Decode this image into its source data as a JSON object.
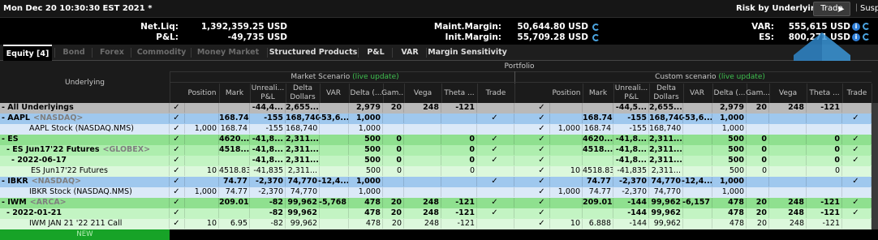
{
  "window": {
    "title": "Mon Dec 20 10:30:30 EST 2021 *",
    "risk_by": "Risk by Underlying",
    "trade_btn": "Trade",
    "susp": "Susp"
  },
  "summary": {
    "netliq_label": "Net.Liq:",
    "netliq_value": "1,392,359.25 USD",
    "pnl_label": "P&L:",
    "pnl_value": "-49,735 USD",
    "maint_label": "Maint.Margin:",
    "maint_value": "50,644.80 USD",
    "init_label": "Init.Margin:",
    "init_value": "55,709.28 USD",
    "var_label": "VAR:",
    "var_value": "555,615 USD",
    "es_label": "ES:",
    "es_value": "800,271 USD"
  },
  "tabs": [
    "Equity [4]",
    "Bond",
    "Forex",
    "Commodity",
    "Money Market",
    "Structured Products",
    "P&L",
    "VAR",
    "Margin Sensitivity"
  ],
  "headers": {
    "portfolio": "Portfolio",
    "underlying": "Underlying",
    "market_scenario": "Market Scenario",
    "custom_scenario": "Custom scenario",
    "live_update": "(live update)",
    "cols": [
      "Position",
      "Mark",
      "Unreali... P&L",
      "Delta Dollars",
      "VAR",
      "Delta (...",
      "Gam...",
      "Vega",
      "Theta ...",
      "Trade"
    ]
  },
  "rows": [
    {
      "name": "- All Underlyings",
      "ex": "",
      "bg": "#b9b9b9",
      "bold": true,
      "trade": false,
      "m": [
        "",
        "",
        "-44,4...",
        "2,655...",
        "",
        "2,979",
        "20",
        "248",
        "-121",
        ""
      ],
      "c": [
        "",
        "",
        "-44,5...",
        "2,655...",
        "",
        "2,979",
        "20",
        "248",
        "-121",
        ""
      ]
    },
    {
      "name": "- AAPL",
      "ex": "<NASDAQ>",
      "bg": "#9fc8ee",
      "bold": true,
      "trade": true,
      "m": [
        "",
        "168.74",
        "-155",
        "168,740",
        "-53,6...",
        "1,000",
        "",
        "",
        "",
        ""
      ],
      "c": [
        "",
        "168.74",
        "-155",
        "168,740",
        "-53,6...",
        "1,000",
        "",
        "",
        "",
        ""
      ]
    },
    {
      "name": "AAPL Stock (NASDAQ.NMS)",
      "ex": "",
      "bg": "#dbe9f8",
      "bold": false,
      "trade": false,
      "indent": 36,
      "m": [
        "1,000",
        "168.74",
        "-155",
        "168,740",
        "",
        "1,000",
        "",
        "",
        "",
        ""
      ],
      "c": [
        "1,000",
        "168.74",
        "-155",
        "168,740",
        "",
        "1,000",
        "",
        "",
        "",
        ""
      ]
    },
    {
      "name": "- ES",
      "ex": "",
      "bg": "#8fe08f",
      "bold": true,
      "trade": true,
      "m": [
        "",
        "4620....",
        "-41,8...",
        "2,311...",
        "",
        "500",
        "0",
        "",
        "0",
        ""
      ],
      "c": [
        "",
        "4620....",
        "-41,8...",
        "2,311...",
        "",
        "500",
        "0",
        "",
        "0",
        ""
      ]
    },
    {
      "name": "- ES Jun17'22 Futures",
      "ex": "<GLOBEX>",
      "bg": "#aeeeae",
      "bold": true,
      "trade": true,
      "indent": 8,
      "m": [
        "",
        "4518....",
        "-41,8...",
        "2,311...",
        "",
        "500",
        "0",
        "",
        "0",
        ""
      ],
      "c": [
        "",
        "4518....",
        "-41,8...",
        "2,311...",
        "",
        "500",
        "0",
        "",
        "0",
        ""
      ]
    },
    {
      "name": "- 2022-06-17",
      "ex": "",
      "bg": "#c3f4c3",
      "bold": true,
      "trade": true,
      "indent": 14,
      "m": [
        "",
        "",
        "-41,8...",
        "2,311...",
        "",
        "500",
        "0",
        "",
        "0",
        ""
      ],
      "c": [
        "",
        "",
        "-41,8...",
        "2,311...",
        "",
        "500",
        "0",
        "",
        "0",
        ""
      ]
    },
    {
      "name": "ES Jun17'22 Futures",
      "ex": "",
      "bg": "#dcf8dc",
      "bold": false,
      "trade": false,
      "indent": 38,
      "m": [
        "10",
        "4518.83",
        "-41,835",
        "2,311...",
        "",
        "500",
        "0",
        "",
        "0",
        ""
      ],
      "c": [
        "10",
        "4518.83",
        "-41,835",
        "2,311...",
        "",
        "500",
        "0",
        "",
        "0",
        ""
      ]
    },
    {
      "name": "- IBKR",
      "ex": "<NASDAQ>",
      "bg": "#9fc8ee",
      "bold": true,
      "trade": true,
      "m": [
        "",
        "74.77",
        "-2,370",
        "74,770",
        "-12,4...",
        "1,000",
        "",
        "",
        "",
        ""
      ],
      "c": [
        "",
        "74.77",
        "-2,370",
        "74,770",
        "-12,4...",
        "1,000",
        "",
        "",
        "",
        ""
      ]
    },
    {
      "name": "IBKR Stock (NASDAQ.NMS)",
      "ex": "",
      "bg": "#dbe9f8",
      "bold": false,
      "trade": false,
      "indent": 36,
      "m": [
        "1,000",
        "74.77",
        "-2,370",
        "74,770",
        "",
        "1,000",
        "",
        "",
        "",
        ""
      ],
      "c": [
        "1,000",
        "74.77",
        "-2,370",
        "74,770",
        "",
        "1,000",
        "",
        "",
        "",
        ""
      ]
    },
    {
      "name": "- IWM",
      "ex": "<ARCA>",
      "bg": "#8fe08f",
      "bold": true,
      "trade": true,
      "m": [
        "",
        "209.01",
        "-82",
        "99,962",
        "-5,768",
        "478",
        "20",
        "248",
        "-121",
        ""
      ],
      "c": [
        "",
        "209.01",
        "-144",
        "99,962",
        "-6,157",
        "478",
        "20",
        "248",
        "-121",
        ""
      ]
    },
    {
      "name": "- 2022-01-21",
      "ex": "",
      "bg": "#c3f4c3",
      "bold": true,
      "trade": true,
      "indent": 8,
      "m": [
        "",
        "",
        "-82",
        "99,962",
        "",
        "478",
        "20",
        "248",
        "-121",
        ""
      ],
      "c": [
        "",
        "",
        "-144",
        "99,962",
        "",
        "478",
        "20",
        "248",
        "-121",
        ""
      ]
    },
    {
      "name": "IWM JAN 21 '22 211 Call",
      "ex": "",
      "bg": "#dcf8dc",
      "bold": false,
      "trade": false,
      "indent": 36,
      "m": [
        "10",
        "6.95",
        "-82",
        "99,962",
        "",
        "478",
        "20",
        "248",
        "-121",
        ""
      ],
      "c": [
        "10",
        "6.888",
        "-144",
        "99,962",
        "",
        "478",
        "20",
        "248",
        "-121",
        ""
      ]
    }
  ],
  "new_label": "NEW",
  "checkmark": "✓"
}
